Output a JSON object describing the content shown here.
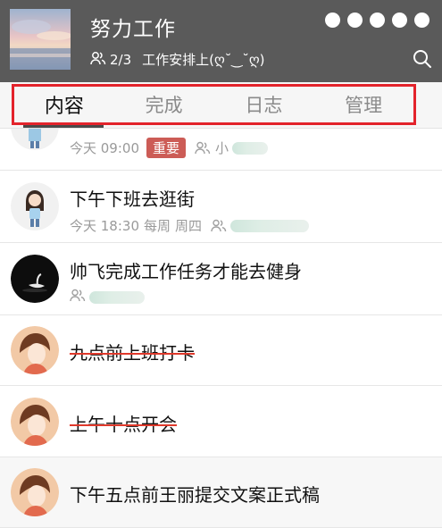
{
  "header": {
    "title": "努力工作",
    "members": "2/3",
    "description": "工作安排上(ღ˘‿˘ღ)",
    "menu_icon": "more-dots-icon",
    "search_icon": "search-icon"
  },
  "tabs": [
    {
      "label": "内容",
      "active": true
    },
    {
      "label": "完成",
      "active": false
    },
    {
      "label": "日志",
      "active": false
    },
    {
      "label": "管理",
      "active": false
    }
  ],
  "tasks": [
    {
      "title": "",
      "time": "今天 09:00",
      "badge": "重要",
      "assignee": "小",
      "done": false
    },
    {
      "title": "下午下班去逛街",
      "time": "今天 18:30",
      "repeat": "每周",
      "weekday": "周四",
      "done": false
    },
    {
      "title": "帅飞完成工作任务才能去健身",
      "done": false
    },
    {
      "title": "九点前上班打卡",
      "done": true
    },
    {
      "title": "上午十点开会",
      "done": true
    },
    {
      "title": "下午五点前王丽提交文案正式稿",
      "done": false
    }
  ],
  "colors": {
    "header_bg": "#5a5a5a",
    "highlight_border": "#e3232b",
    "badge_bg": "#cc5c56",
    "strike": "#e0392b"
  }
}
